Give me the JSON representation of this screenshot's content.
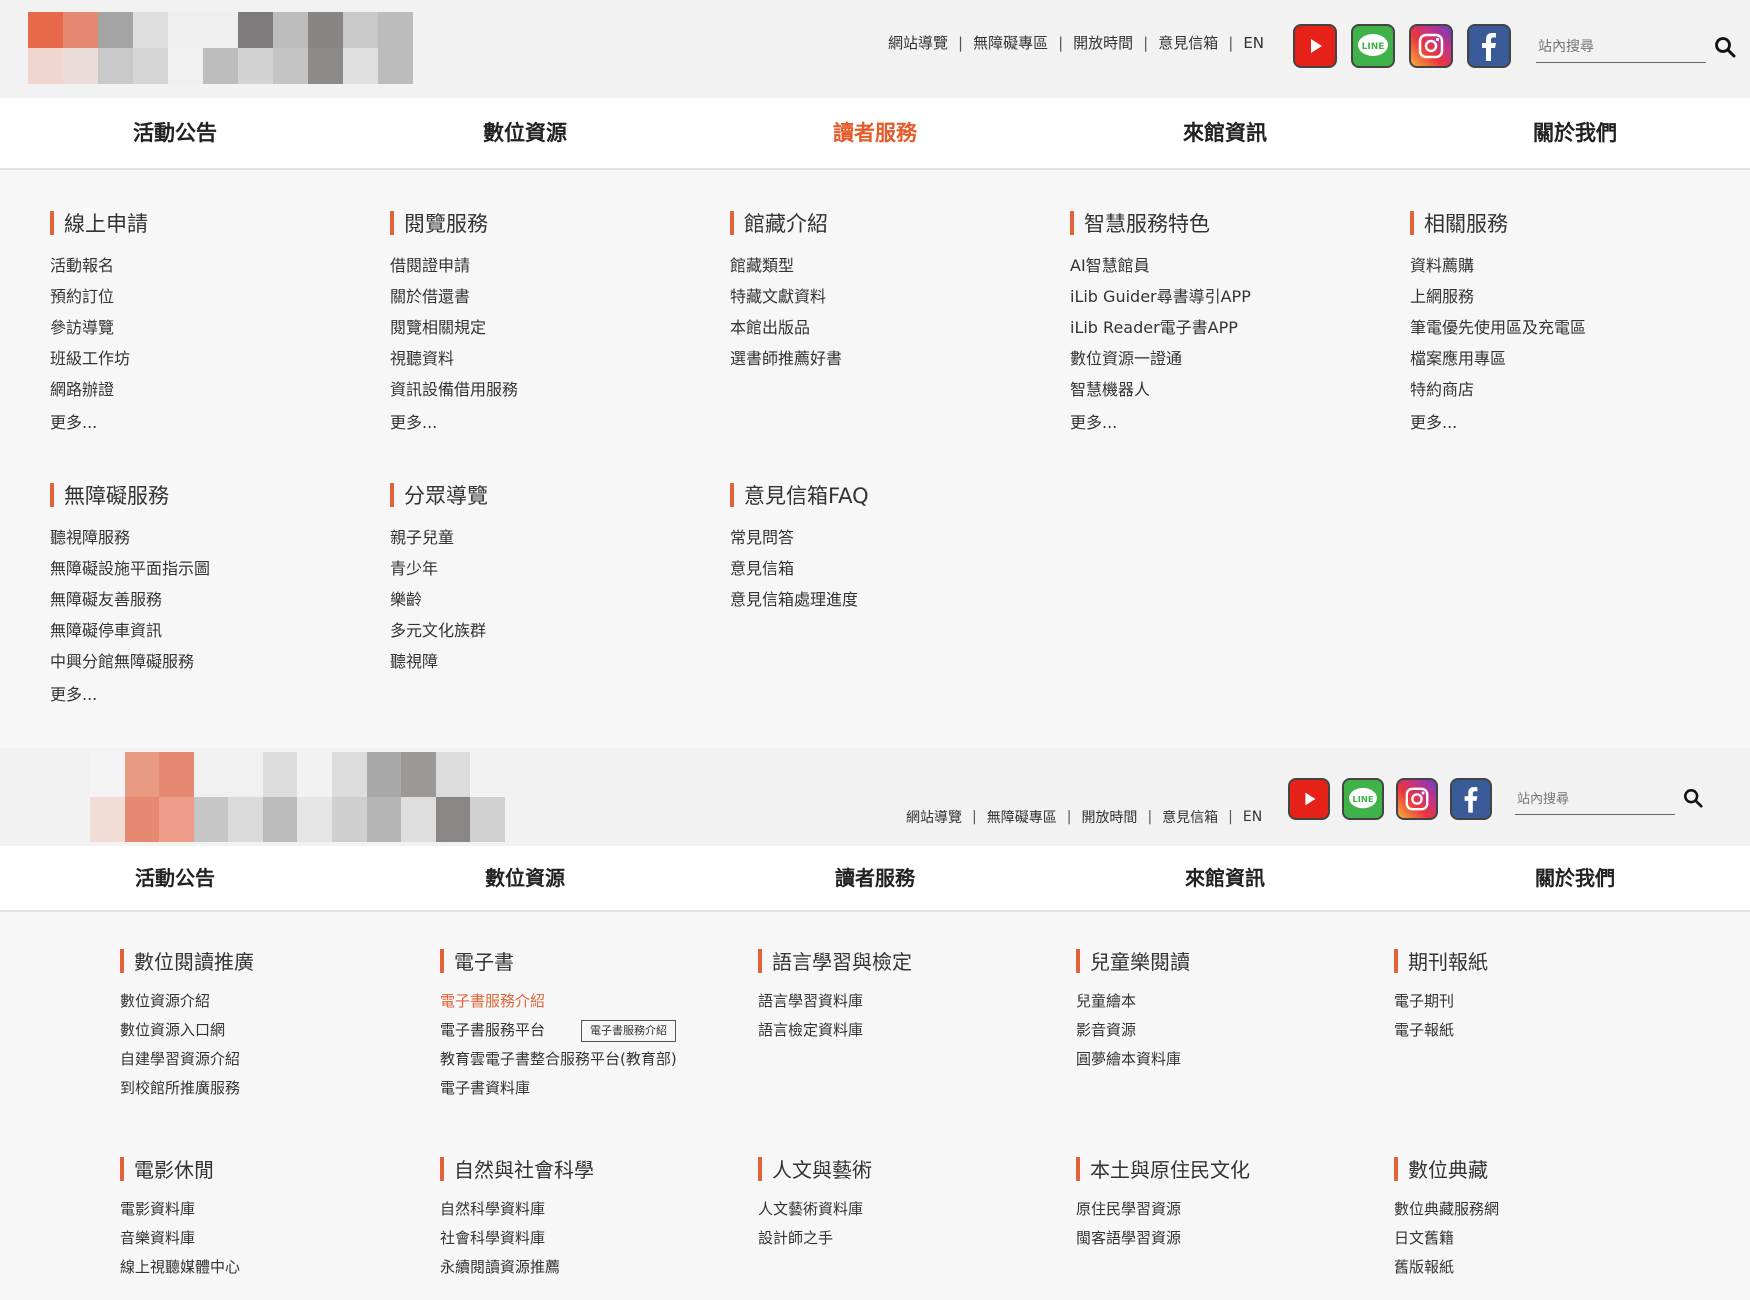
{
  "util_links": [
    "網站導覽",
    "無障礙專區",
    "開放時間",
    "意見信箱",
    "EN"
  ],
  "search_placeholder": "站內搜尋",
  "social": [
    "youtube-icon",
    "line-icon",
    "instagram-icon",
    "facebook-icon"
  ],
  "social_line_text": "LINE",
  "nav": [
    "活動公告",
    "數位資源",
    "讀者服務",
    "來館資訊",
    "關於我們"
  ],
  "more_label": "更多...",
  "panel1": {
    "active_nav": 2,
    "columns": [
      {
        "title": "線上申請",
        "items": [
          "活動報名",
          "預約訂位",
          "參訪導覽",
          "班級工作坊",
          "網路辦證"
        ],
        "more": true
      },
      {
        "title": "閱覽服務",
        "items": [
          "借閱證申請",
          "關於借還書",
          "閱覽相關規定",
          "視聽資料",
          "資訊設備借用服務"
        ],
        "more": true
      },
      {
        "title": "館藏介紹",
        "items": [
          "館藏類型",
          "特藏文獻資料",
          "本館出版品",
          "選書師推薦好書"
        ],
        "more": false
      },
      {
        "title": "智慧服務特色",
        "items": [
          "AI智慧館員",
          "iLib Guider尋書導引APP",
          "iLib Reader電子書APP",
          "數位資源一證通",
          "智慧機器人"
        ],
        "more": true
      },
      {
        "title": "相關服務",
        "items": [
          "資料薦購",
          "上網服務",
          "筆電優先使用區及充電區",
          "檔案應用專區",
          "特約商店"
        ],
        "more": true
      },
      {
        "title": "無障礙服務",
        "items": [
          "聽視障服務",
          "無障礙設施平面指示圖",
          "無障礙友善服務",
          "無障礙停車資訊",
          "中興分館無障礙服務"
        ],
        "more": true
      },
      {
        "title": "分眾導覽",
        "items": [
          "親子兒童",
          "青少年",
          "樂齡",
          "多元文化族群",
          "聽視障"
        ],
        "more": false
      },
      {
        "title": "意見信箱FAQ",
        "items": [
          "常見問答",
          "意見信箱",
          "意見信箱處理進度"
        ],
        "more": false
      }
    ]
  },
  "panel2": {
    "columns": [
      {
        "title": "數位閱讀推廣",
        "items": [
          "數位資源介紹",
          "數位資源入口網",
          "自建學習資源介紹",
          "到校館所推廣服務"
        ]
      },
      {
        "title": "電子書",
        "items": [
          "電子書服務介紹",
          "電子書服務平台",
          "教育雲電子書整合服務平台(教育部)",
          "電子書資料庫"
        ],
        "highlight": 0,
        "tag": "電子書服務介紹"
      },
      {
        "title": "語言學習與檢定",
        "items": [
          "語言學習資料庫",
          "語言檢定資料庫"
        ]
      },
      {
        "title": "兒童樂閱讀",
        "items": [
          "兒童繪本",
          "影音資源",
          "圓夢繪本資料庫"
        ]
      },
      {
        "title": "期刊報紙",
        "items": [
          "電子期刊",
          "電子報紙"
        ]
      },
      {
        "title": "電影休閒",
        "items": [
          "電影資料庫",
          "音樂資料庫",
          "線上視聽媒體中心"
        ]
      },
      {
        "title": "自然與社會科學",
        "items": [
          "自然科學資料庫",
          "社會科學資料庫",
          "永續閱讀資源推薦"
        ]
      },
      {
        "title": "人文與藝術",
        "items": [
          "人文藝術資料庫",
          "設計師之手"
        ]
      },
      {
        "title": "本土與原住民文化",
        "items": [
          "原住民學習資源",
          "閩客語學習資源"
        ]
      },
      {
        "title": "數位典藏",
        "items": [
          "數位典藏服務網",
          "日文舊籍",
          "舊版報紙"
        ]
      }
    ]
  }
}
